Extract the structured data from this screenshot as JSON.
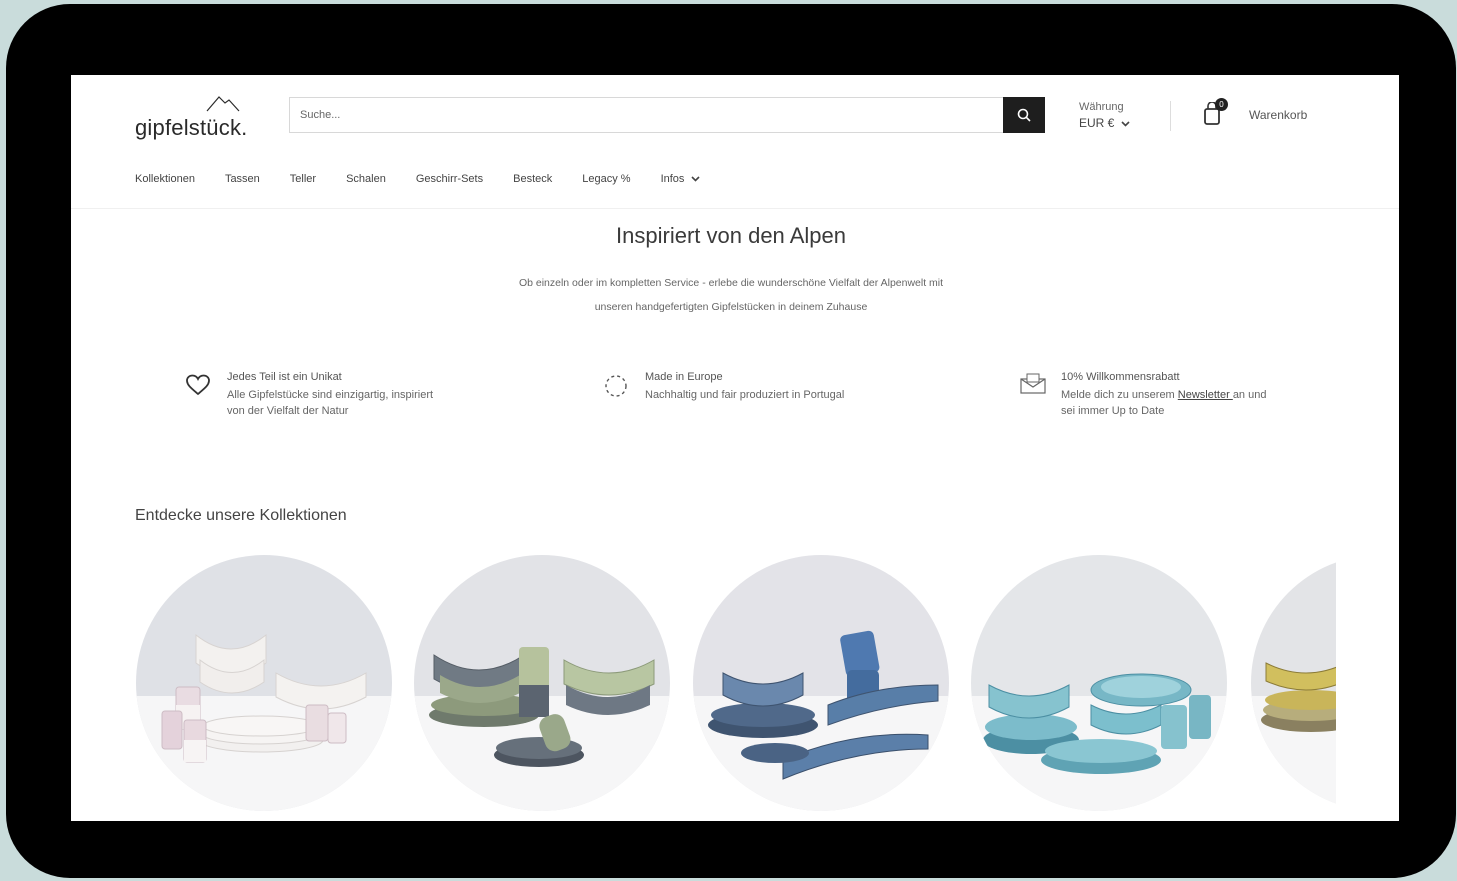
{
  "brand": {
    "name": "gipfelstück."
  },
  "search": {
    "placeholder": "Suche..."
  },
  "currency": {
    "label": "Währung",
    "value": "EUR €"
  },
  "cart": {
    "count": "0",
    "label": "Warenkorb"
  },
  "nav": {
    "items": [
      "Kollektionen",
      "Tassen",
      "Teller",
      "Schalen",
      "Geschirr-Sets",
      "Besteck",
      "Legacy %",
      "Infos"
    ]
  },
  "hero": {
    "title": "Inspiriert von den Alpen",
    "line1": "Ob einzeln oder im kompletten Service - erlebe die wunderschöne Vielfalt der Alpenwelt mit",
    "line2": "unseren handgefertigten Gipfelstücken in deinem Zuhause"
  },
  "features": [
    {
      "icon": "heart-icon",
      "title": "Jedes Teil ist ein Unikat",
      "text": "Alle Gipfelstücke sind einzigartig, inspiriert von der Vielfalt der Natur"
    },
    {
      "icon": "globe-icon",
      "title": "Made in Europe",
      "text": "Nachhaltig und fair produziert in Portugal"
    },
    {
      "icon": "newsletter-icon",
      "title": "10% Willkommensrabatt",
      "text_before": "Melde dich zu unserem ",
      "link": "Newsletter ",
      "text_after": "an und sei immer Up to Date"
    }
  ],
  "collections": {
    "title": "Entdecke unsere Kollektionen"
  },
  "colors": {
    "device": "#000000",
    "background": "#c9dcdb",
    "search_button": "#1e1e1e"
  }
}
